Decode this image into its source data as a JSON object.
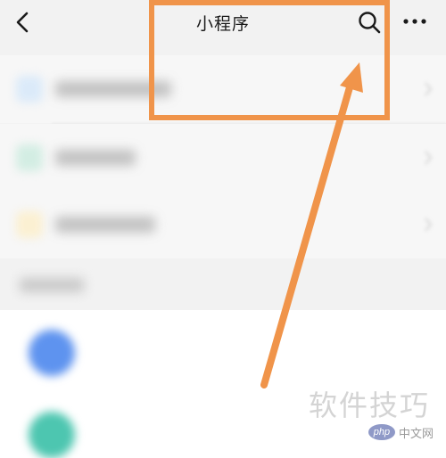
{
  "navbar": {
    "title": "小程序",
    "back_icon": "chevron-left-icon",
    "search_icon": "search-icon",
    "more_icon": "more-horizontal-icon"
  },
  "annotation": {
    "highlight_color": "#f0944a"
  },
  "watermark": {
    "text": "软件技巧",
    "logo_text": "php",
    "site_text": "中文网"
  },
  "colors": {
    "nav_background": "#f2f2f2",
    "list_background": "#f7f7f7",
    "item_blue": "#dbeaf9",
    "item_green": "#d3ede3",
    "item_yellow": "#fbf0d2",
    "avatar_blue": "#5e93ef",
    "avatar_teal": "#4dc6b0"
  }
}
